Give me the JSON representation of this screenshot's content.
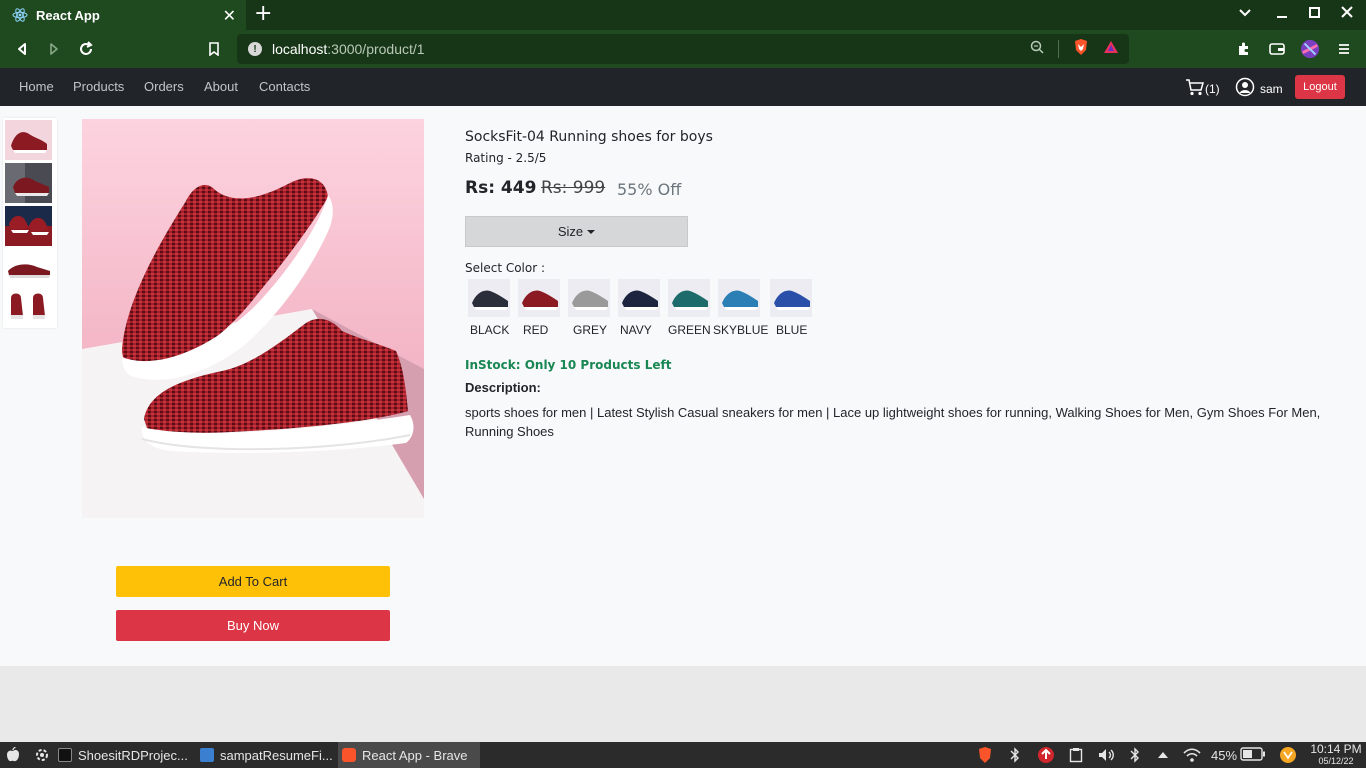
{
  "browser": {
    "tab_title": "React App",
    "url_host": "localhost",
    "url_path": ":3000/product/1"
  },
  "nav": {
    "links": [
      "Home",
      "Products",
      "Orders",
      "About",
      "Contacts"
    ],
    "cart_count": "(1)",
    "user": "sam",
    "logout": "Logout"
  },
  "product": {
    "title": "SocksFit-04 Running shoes for boys",
    "rating": "Rating - 2.5/5",
    "price": "Rs: 449",
    "mrp": "Rs: 999",
    "discount": "55% Off",
    "size_label": "Size",
    "select_color_label": "Select Color :",
    "colors": [
      {
        "name": "BLACK",
        "swatch": "#2a2d3a"
      },
      {
        "name": "RED",
        "swatch": "#8b1a22"
      },
      {
        "name": "GREY",
        "swatch": "#9a9a9a"
      },
      {
        "name": "NAVY",
        "swatch": "#1d2440"
      },
      {
        "name": "GREEN",
        "swatch": "#1e6b6b"
      },
      {
        "name": "SKYBLUE",
        "swatch": "#2b7fb5"
      },
      {
        "name": "BLUE",
        "swatch": "#2a4fa8"
      }
    ],
    "stock": "InStock: Only 10 Products Left",
    "description_heading": "Description:",
    "description": "sports shoes for men | Latest Stylish Casual sneakers for men | Lace up lightweight shoes for running, Walking Shoes for Men, Gym Shoes For Men, Running Shoes",
    "add_to_cart": "Add To Cart",
    "buy_now": "Buy Now"
  },
  "taskbar": {
    "tasks": [
      "ShoesitRDProjec...",
      "sampatResumeFi...",
      "React App - Brave"
    ],
    "battery": "45%",
    "time": "10:14 PM",
    "date": "05/12/22"
  }
}
